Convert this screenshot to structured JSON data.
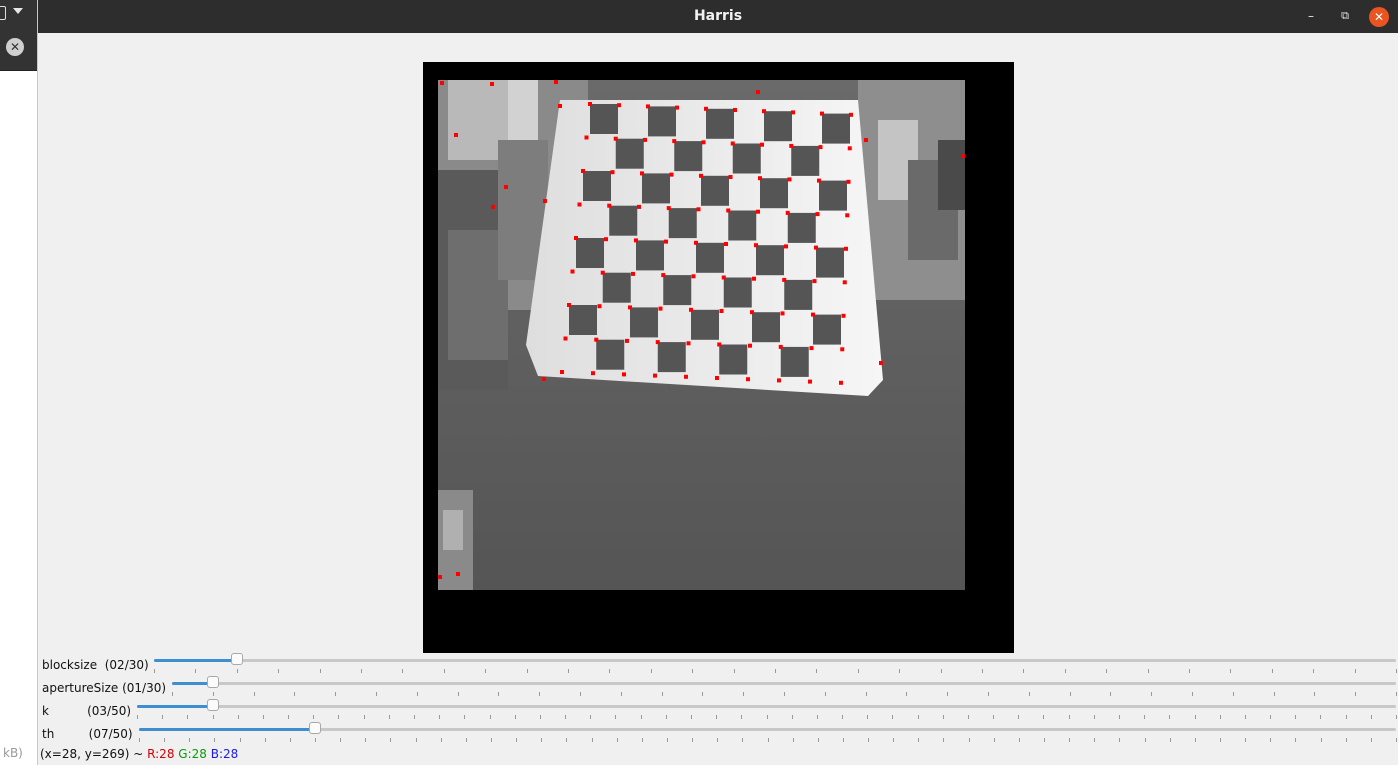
{
  "window": {
    "title": "Harris",
    "minimize_glyph": "–",
    "maximize_glyph": "⧉",
    "close_glyph": "✕"
  },
  "background_app": {
    "close_glyph": "✕",
    "status_fragment": "kB)"
  },
  "image": {
    "description_icon": "harris-corner-result-image",
    "marker_color": "#ff0000"
  },
  "trackbars": [
    {
      "name": "blocksize",
      "label": "blocksize  (02/30)",
      "value": 2,
      "max": 30
    },
    {
      "name": "aperturesize",
      "label": "apertureSize (01/30)",
      "value": 1,
      "max": 30
    },
    {
      "name": "k",
      "label": "k          (03/50)",
      "value": 3,
      "max": 50
    },
    {
      "name": "th",
      "label": "th         (07/50)",
      "value": 7,
      "max": 50
    }
  ],
  "status": {
    "coords": "(x=28, y=269) ~ ",
    "r": "R:28",
    "g": "G:28",
    "b": "B:28"
  },
  "colors": {
    "accent": "#3d8fd1",
    "titlebar": "#2d2d2d",
    "close_button": "#e95420"
  }
}
